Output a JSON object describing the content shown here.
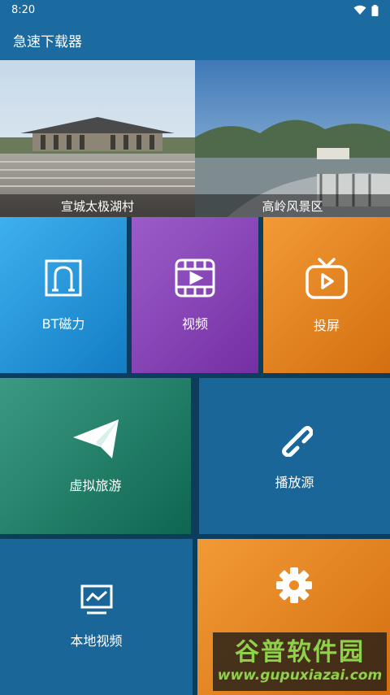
{
  "status": {
    "time": "8:20"
  },
  "app": {
    "title": "急速下载器"
  },
  "banners": [
    {
      "caption": "宣城太极湖村"
    },
    {
      "caption": "高岭风景区"
    }
  ],
  "tiles": {
    "bt": {
      "label": "BT磁力",
      "color": "#1f8fd3"
    },
    "video": {
      "label": "视频",
      "color": "#8a4bb8"
    },
    "cast": {
      "label": "投屏",
      "color": "#ec8a22"
    },
    "vr": {
      "label": "虚拟旅游",
      "color": "#1d7e63"
    },
    "source": {
      "label": "播放源",
      "color": "#1a6699"
    },
    "local": {
      "label": "本地视频",
      "color": "#1a6699"
    },
    "settings": {
      "label": "",
      "color": "#ec8a22"
    }
  },
  "watermark": {
    "title": "谷普软件园",
    "url": "www.gupuxiazai.com"
  }
}
